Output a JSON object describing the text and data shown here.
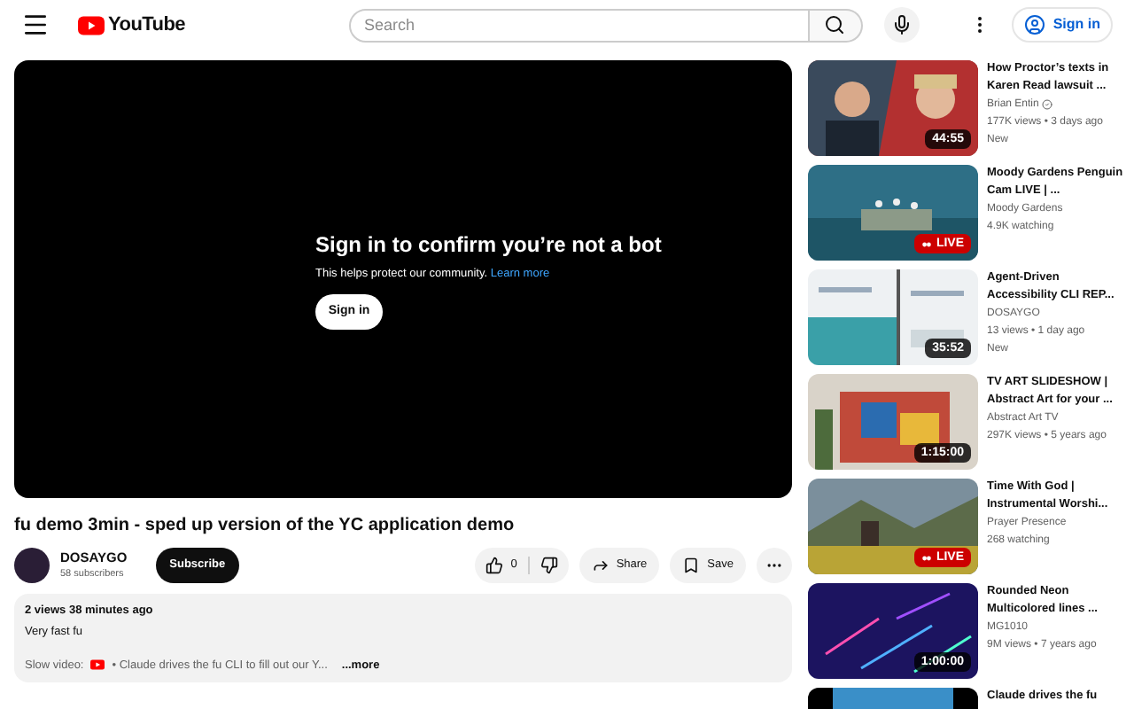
{
  "header": {
    "logo": "YouTube",
    "search": {
      "placeholder": "Search"
    },
    "sign_in": "Sign in"
  },
  "player": {
    "title": "Sign in to confirm you’re not a bot",
    "message": "This helps protect our community.",
    "link": "Learn more",
    "button": "Sign in"
  },
  "video": {
    "title": "fu demo 3min - sped up version of the YC application demo",
    "channel": "DOSAYGO",
    "subscribers": "58 subscribers",
    "subscribe": "Subscribe",
    "likes": "0",
    "share": "Share",
    "save": "Save"
  },
  "description": {
    "views": "2 views",
    "age": "38 minutes ago",
    "text": "Very fast fu",
    "slow_label": "Slow video:",
    "link": "• Claude drives the fu CLI to fill out our Y...",
    "more": "...more"
  },
  "related": [
    {
      "title": "How Proctor’s texts in Karen Read lawsuit ...",
      "channel": "Brian Entin",
      "verified": true,
      "meta": "177K views • 3 days ago",
      "tag": "New",
      "badge": {
        "kind": "duration",
        "text": "44:55"
      }
    },
    {
      "title": "Moody Gardens Penguin Cam LIVE | ...",
      "channel": "Moody Gardens",
      "verified": false,
      "meta": "4.9K watching",
      "badge": {
        "kind": "live",
        "text": "LIVE"
      }
    },
    {
      "title": "Agent-Driven Accessibility CLI REP...",
      "channel": "DOSAYGO",
      "verified": false,
      "meta": "13 views • 1 day ago",
      "tag": "New",
      "badge": {
        "kind": "duration",
        "text": "35:52"
      }
    },
    {
      "title": "TV ART SLIDESHOW | Abstract Art for your ...",
      "channel": "Abstract Art TV",
      "verified": false,
      "meta": "297K views • 5 years ago",
      "badge": {
        "kind": "duration",
        "text": "1:15:00"
      }
    },
    {
      "title": "Time With God | Instrumental Worshi...",
      "channel": "Prayer Presence",
      "verified": false,
      "meta": "268 watching",
      "badge": {
        "kind": "live",
        "text": "LIVE"
      }
    },
    {
      "title": "Rounded Neon Multicolored lines ...",
      "channel": "MG1010",
      "verified": false,
      "meta": "9M views • 7 years ago",
      "badge": {
        "kind": "duration",
        "text": "1:00:00"
      }
    },
    {
      "title": "Claude drives the fu"
    }
  ]
}
